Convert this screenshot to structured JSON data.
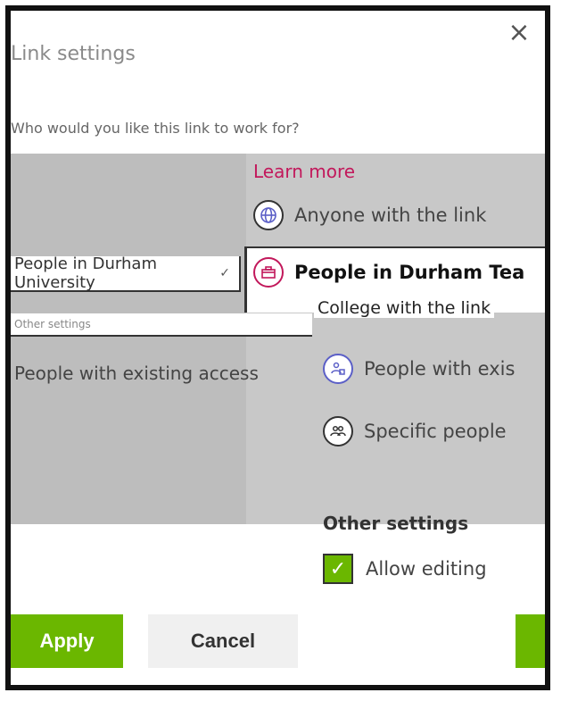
{
  "dialog": {
    "title": "Link settings",
    "subtitle": "Who would you like this link to work for?",
    "close_label": "×"
  },
  "left_panel": {
    "dropdown_value": "People in Durham University",
    "sub_text": "Other settings",
    "existing_text": "People with existing access"
  },
  "options": {
    "learn_more": "Learn more",
    "anyone": "Anyone with the link",
    "durham": "People in Durham Tea",
    "durham_sub": "College with the link",
    "existing": "People with exis",
    "specific": "Specific people"
  },
  "settings": {
    "other_settings_label": "Other settings",
    "allow_editing_label": "Allow editing",
    "allow_editing_checked": true
  },
  "buttons": {
    "apply": "Apply",
    "cancel": "Cancel"
  },
  "icons": {
    "globe": "globe-icon",
    "building": "building-icon",
    "people_existing": "people-existing-icon",
    "specific_people": "specific-people-icon"
  },
  "colors": {
    "accent_green": "#6bb700",
    "accent_purple": "#5b5fc7",
    "accent_pink": "#c2185b"
  }
}
